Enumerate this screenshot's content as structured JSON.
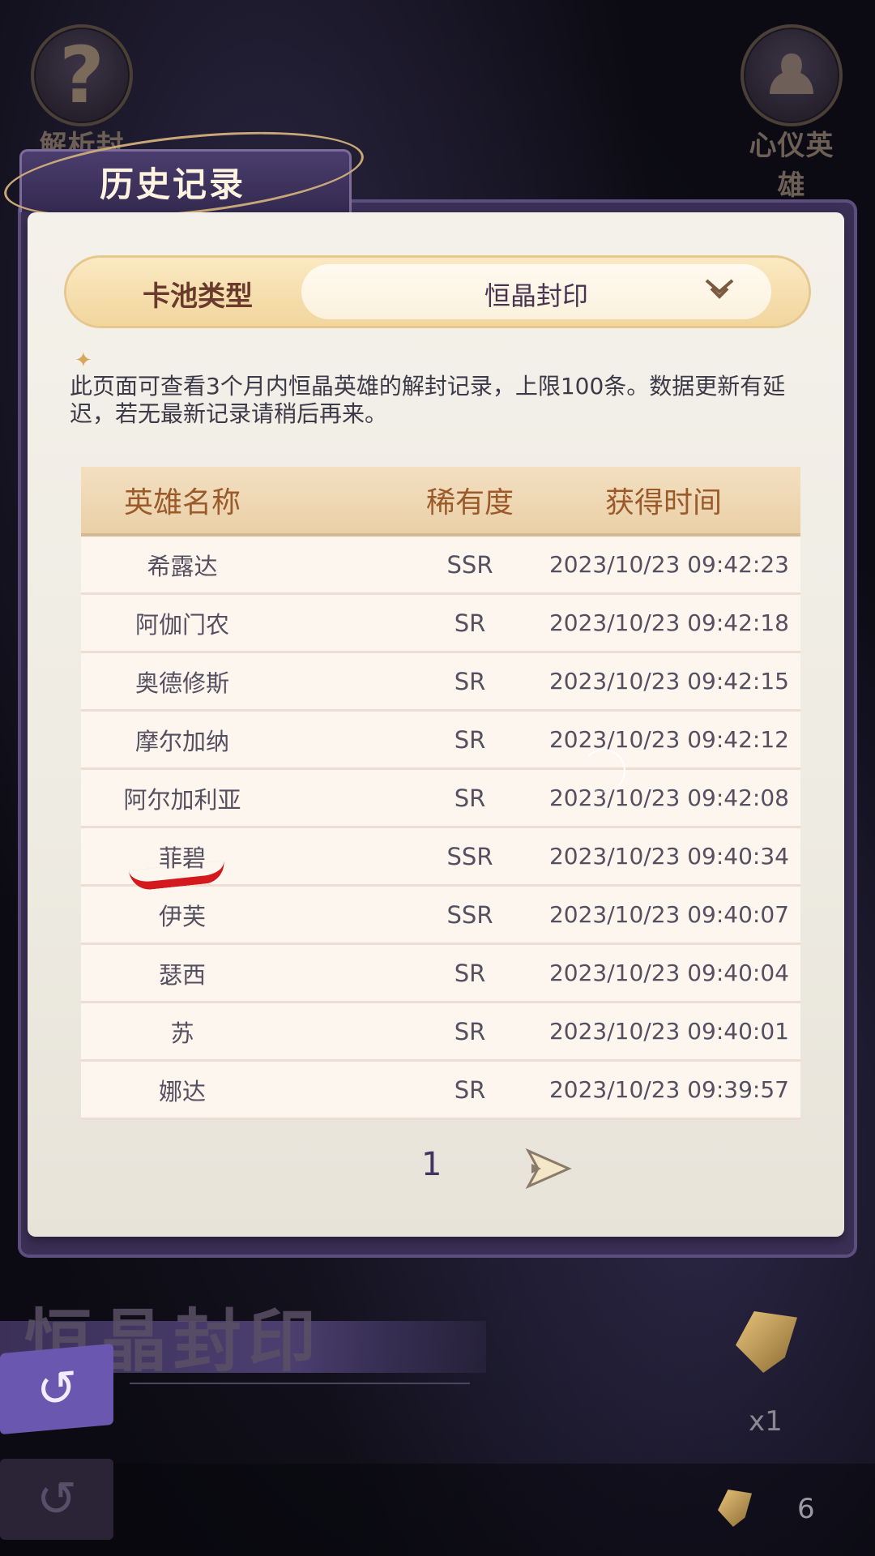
{
  "top_buttons": {
    "analyze_label": "解析封印",
    "favorite_label": "心仪英雄"
  },
  "panel": {
    "title": "历史记录",
    "pool_label": "卡池类型",
    "pool_value": "恒晶封印",
    "notice": "此页面可查看3个月内恒晶英雄的解封记录，上限100条。数据更新有延迟，若无最新记录请稍后再来。"
  },
  "table": {
    "headers": [
      "英雄名称",
      "稀有度",
      "获得时间"
    ],
    "rows": [
      {
        "name": "希露达",
        "rarity": "SSR",
        "time": "2023/10/23 09:42:23"
      },
      {
        "name": "阿伽门农",
        "rarity": "SR",
        "time": "2023/10/23 09:42:18"
      },
      {
        "name": "奥德修斯",
        "rarity": "SR",
        "time": "2023/10/23 09:42:15"
      },
      {
        "name": "摩尔加纳",
        "rarity": "SR",
        "time": "2023/10/23 09:42:12"
      },
      {
        "name": "阿尔加利亚",
        "rarity": "SR",
        "time": "2023/10/23 09:42:08"
      },
      {
        "name": "菲碧",
        "rarity": "SSR",
        "time": "2023/10/23 09:40:34"
      },
      {
        "name": "伊芙",
        "rarity": "SSR",
        "time": "2023/10/23 09:40:07"
      },
      {
        "name": "瑟西",
        "rarity": "SR",
        "time": "2023/10/23 09:40:04"
      },
      {
        "name": "苏",
        "rarity": "SR",
        "time": "2023/10/23 09:40:01"
      },
      {
        "name": "娜达",
        "rarity": "SR",
        "time": "2023/10/23 09:39:57"
      }
    ]
  },
  "pagination": {
    "page": "1"
  },
  "bottom": {
    "seal_title": "恒晶封印",
    "crystal_multiplier": "x1",
    "currency_count": "6"
  },
  "colors": {
    "panel_purple": "#3a3056",
    "header_text": "#9a5a2a",
    "highlight_mark": "#d3181e"
  }
}
